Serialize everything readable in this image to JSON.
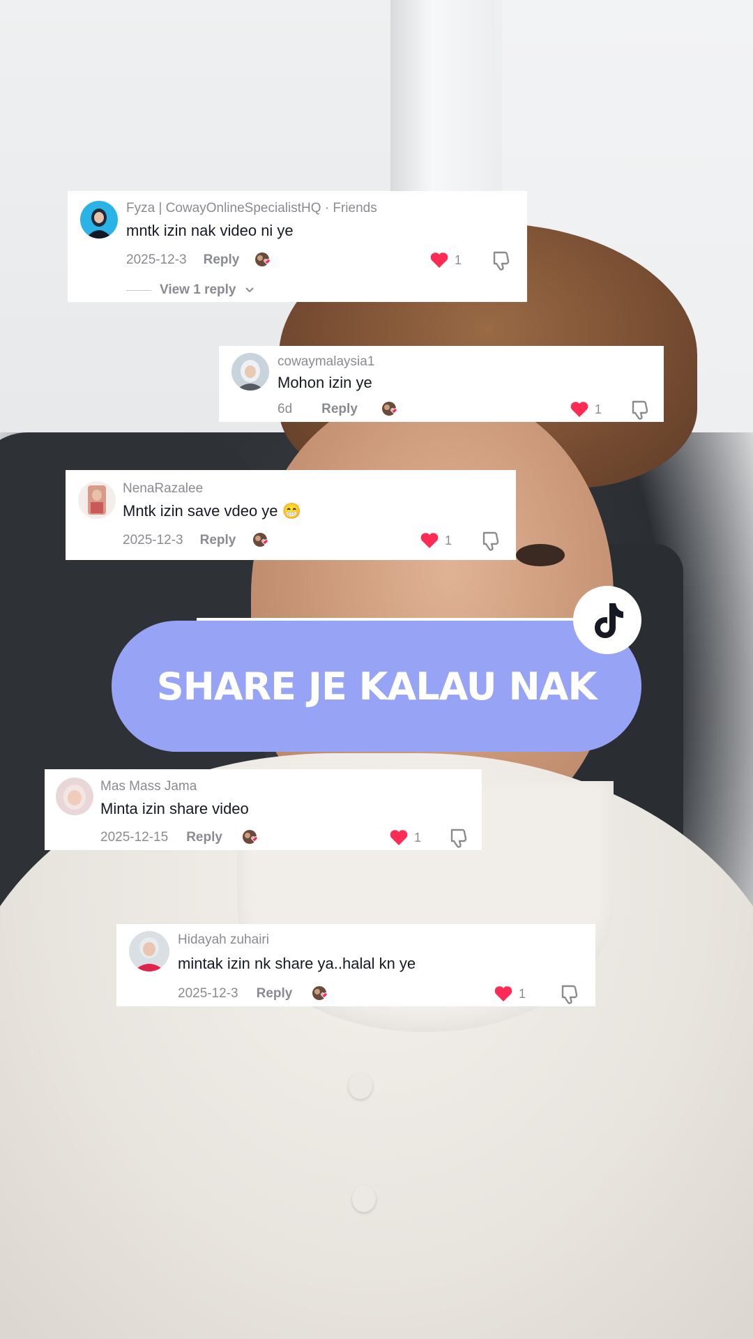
{
  "banner": {
    "text": "SHARE JE KALAU NAK",
    "color": "#97a4f5",
    "badge_icon": "tiktok-logo-icon"
  },
  "comments": [
    {
      "username": "Fyza | CowayOnlineSpecialistHQ · Friends",
      "text": "mntk izin nak video ni ye",
      "date": "2025-12-3",
      "reply_label": "Reply",
      "likes": "1",
      "view_replies": "View 1 reply"
    },
    {
      "username": "cowaymalaysia1",
      "text": "Mohon izin ye",
      "date": "6d",
      "reply_label": "Reply",
      "likes": "1"
    },
    {
      "username": "NenaRazalee",
      "text": "Mntk izin save vdeo ye 😁",
      "date": "2025-12-3",
      "reply_label": "Reply",
      "likes": "1"
    },
    {
      "username": "Mas Mass Jama",
      "text": "Minta izin share video",
      "date": "2025-12-15",
      "reply_label": "Reply",
      "likes": "1"
    },
    {
      "username": "Hidayah zuhairi",
      "text": "mintak izin nk share ya..halal kn ye",
      "date": "2025-12-3",
      "reply_label": "Reply",
      "likes": "1"
    }
  ],
  "colors": {
    "like_heart": "#fe2c55",
    "muted_text": "#8a8b91",
    "primary_text": "#161823"
  }
}
